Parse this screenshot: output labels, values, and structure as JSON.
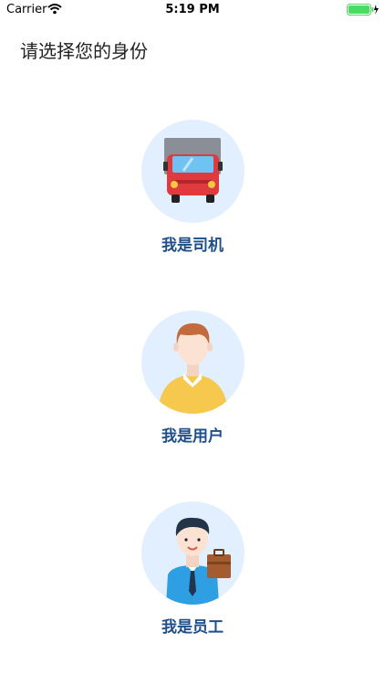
{
  "status_bar": {
    "carrier": "Carrier",
    "time": "5:19 PM",
    "battery_color": "#4cd964"
  },
  "page": {
    "title": "请选择您的身份"
  },
  "roles": [
    {
      "label": "我是司机",
      "icon": "truck-icon"
    },
    {
      "label": "我是用户",
      "icon": "user-icon"
    },
    {
      "label": "我是员工",
      "icon": "employee-icon"
    }
  ],
  "colors": {
    "avatar_bg": "#e2efff",
    "label": "#1f4f8a"
  }
}
